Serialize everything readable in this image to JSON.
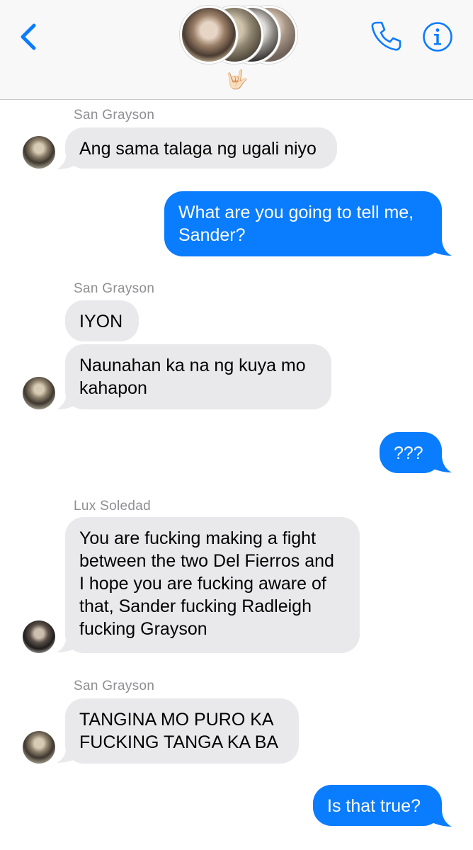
{
  "header": {
    "back_icon": "chevron-left-icon",
    "call_icon": "phone-icon",
    "info_icon": "info-icon",
    "group_emoji": "🤟🏻",
    "accent_color": "#0a7cfe"
  },
  "messages": [
    {
      "sender": "San Grayson",
      "text": "Ang sama talaga ng ugali niyo",
      "direction": "incoming"
    },
    {
      "text": "What are you going to tell me,\nSander?",
      "direction": "outgoing"
    },
    {
      "sender": "San Grayson",
      "text": "IYON",
      "direction": "incoming"
    },
    {
      "text": "Naunahan ka na ng kuya mo\nkahapon",
      "direction": "incoming"
    },
    {
      "text": "???",
      "direction": "outgoing"
    },
    {
      "sender": "Lux Soledad",
      "text": "You are fucking making a fight\nbetween the two Del Fierros and\nI hope you are fucking aware of\nthat, Sander fucking Radleigh\nfucking Grayson",
      "direction": "incoming"
    },
    {
      "sender": "San Grayson",
      "text": "TANGINA MO PURO KA\nFUCKING TANGA KA BA",
      "direction": "incoming"
    },
    {
      "text": "Is that true?",
      "direction": "outgoing"
    }
  ]
}
